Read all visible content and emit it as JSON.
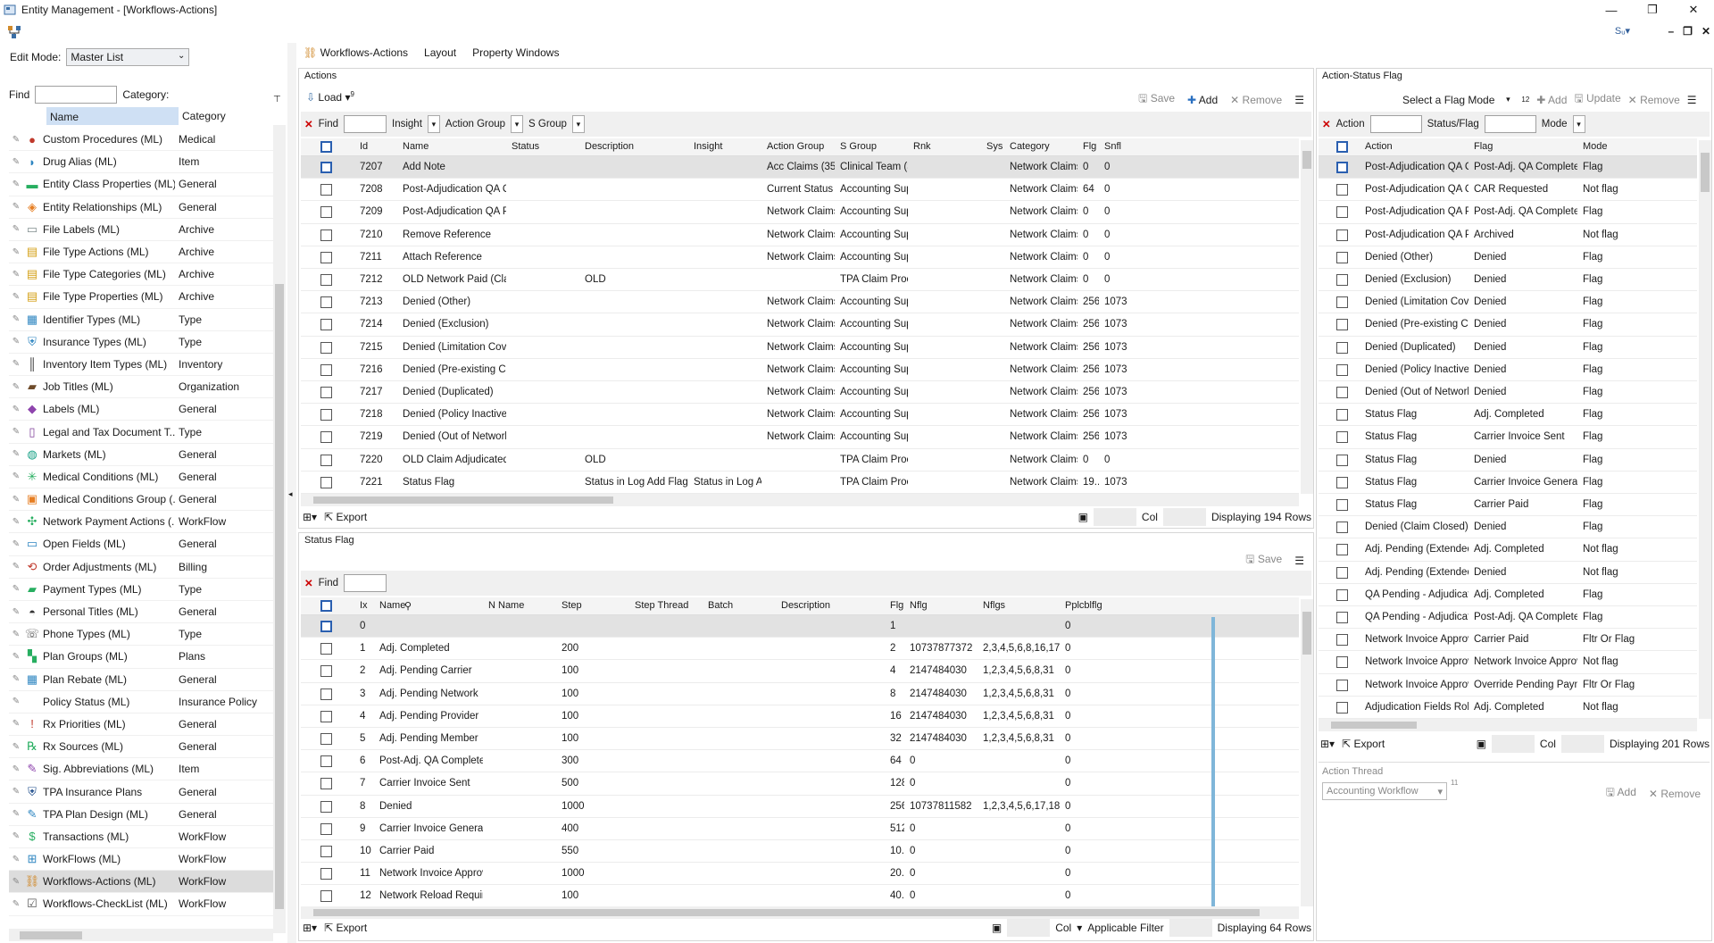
{
  "window": {
    "title": "Entity Management - [Workflows-Actions]",
    "controls": [
      "—",
      "❐",
      "✕"
    ],
    "mdi": [
      "–",
      "❐",
      "✕"
    ],
    "user_glyph": "Sᵤ▾"
  },
  "left": {
    "edit_mode_label": "Edit Mode:",
    "edit_mode_value": "Master List",
    "find_label": "Find",
    "category_label": "Category:",
    "col_name": "Name",
    "col_category": "Category",
    "items": [
      {
        "name": "Custom Procedures (ML)",
        "category": "Medical",
        "icon": "procedure-icon"
      },
      {
        "name": "Drug Alias (ML)",
        "category": "Item",
        "icon": "pill-icon"
      },
      {
        "name": "Entity Class Properties (ML)",
        "category": "General",
        "icon": "class-icon"
      },
      {
        "name": "Entity Relationships (ML)",
        "category": "General",
        "icon": "relationship-icon"
      },
      {
        "name": "File Labels (ML)",
        "category": "Archive",
        "icon": "label-icon"
      },
      {
        "name": "File Type Actions (ML)",
        "category": "Archive",
        "icon": "file-action-icon"
      },
      {
        "name": "File Type Categories (ML)",
        "category": "Archive",
        "icon": "file-category-icon"
      },
      {
        "name": "File Type Properties (ML)",
        "category": "Archive",
        "icon": "file-property-icon"
      },
      {
        "name": "Identifier Types (ML)",
        "category": "Type",
        "icon": "identifier-icon"
      },
      {
        "name": "Insurance Types (ML)",
        "category": "Type",
        "icon": "shield-icon"
      },
      {
        "name": "Inventory Item Types (ML)",
        "category": "Inventory",
        "icon": "barcode-icon"
      },
      {
        "name": "Job Titles (ML)",
        "category": "Organization",
        "icon": "briefcase-icon"
      },
      {
        "name": "Labels (ML)",
        "category": "General",
        "icon": "tag-icon"
      },
      {
        "name": "Legal and Tax Document T...",
        "category": "Type",
        "icon": "document-icon"
      },
      {
        "name": "Markets (ML)",
        "category": "General",
        "icon": "globe-icon"
      },
      {
        "name": "Medical Conditions (ML)",
        "category": "General",
        "icon": "virus-icon"
      },
      {
        "name": "Medical Conditions Group (...",
        "category": "General",
        "icon": "clipboard-icon"
      },
      {
        "name": "Network Payment Actions (...",
        "category": "WorkFlow",
        "icon": "network-icon"
      },
      {
        "name": "Open Fields (ML)",
        "category": "General",
        "icon": "field-icon"
      },
      {
        "name": "Order Adjustments (ML)",
        "category": "Billing",
        "icon": "adjust-icon"
      },
      {
        "name": "Payment Types (ML)",
        "category": "Type",
        "icon": "money-icon"
      },
      {
        "name": "Personal Titles (ML)",
        "category": "General",
        "icon": "hat-icon"
      },
      {
        "name": "Phone Types (ML)",
        "category": "Type",
        "icon": "phone-icon"
      },
      {
        "name": "Plan Groups (ML)",
        "category": "Plans",
        "icon": "plan-group-icon"
      },
      {
        "name": "Plan Rebate (ML)",
        "category": "General",
        "icon": "rebate-icon"
      },
      {
        "name": "Policy Status (ML)",
        "category": "Insurance Policy",
        "icon": ""
      },
      {
        "name": "Rx Priorities (ML)",
        "category": "General",
        "icon": "alert-icon"
      },
      {
        "name": "Rx Sources (ML)",
        "category": "General",
        "icon": "rx-icon"
      },
      {
        "name": "Sig. Abbreviations (ML)",
        "category": "Item",
        "icon": "sig-icon"
      },
      {
        "name": "TPA Insurance Plans",
        "category": "General",
        "icon": "tpa-shield-icon"
      },
      {
        "name": "TPA Plan Design (ML)",
        "category": "General",
        "icon": "design-icon"
      },
      {
        "name": "Transactions (ML)",
        "category": "WorkFlow",
        "icon": "transaction-icon"
      },
      {
        "name": "WorkFlows (ML)",
        "category": "WorkFlow",
        "icon": "workflow-icon"
      },
      {
        "name": "Workflows-Actions (ML)",
        "category": "WorkFlow",
        "icon": "workflow-actions-icon",
        "selected": true
      },
      {
        "name": "Workflows-CheckList (ML)",
        "category": "WorkFlow",
        "icon": "checklist-icon"
      }
    ]
  },
  "tabs": [
    "Workflows-Actions",
    "Layout",
    "Property Windows"
  ],
  "actions": {
    "title": "Actions",
    "load": "Load",
    "load_count": "9",
    "save": "Save",
    "add": "Add",
    "remove": "Remove",
    "find": "Find",
    "insight": "Insight",
    "action_group": "Action Group",
    "s_group": "S Group",
    "columns": [
      "Id",
      "Name",
      "Status",
      "Description",
      "Insight",
      "Action Group",
      "S Group",
      "Rnk",
      "Sys",
      "Category",
      "Flg",
      "Snfl"
    ],
    "rows": [
      [
        "7207",
        "Add Note",
        "",
        "",
        "",
        "Acc Claims (35), ...",
        "Clinical Team (31...",
        "",
        "",
        "Network Claims",
        "0",
        "0"
      ],
      [
        "7208",
        "Post-Adjudication QA Compl...",
        "",
        "",
        "",
        "Current Status Pr...",
        "Accounting Supe...",
        "",
        "",
        "Network Claims",
        "64",
        "0"
      ],
      [
        "7209",
        "Post-Adjudication QA Pending",
        "",
        "",
        "",
        "Network Claims A...",
        "Accounting Supe...",
        "",
        "",
        "Network Claims",
        "0",
        "0"
      ],
      [
        "7210",
        "Remove Reference",
        "",
        "",
        "",
        "Network Claims A...",
        "Accounting Supe...",
        "",
        "",
        "Network Claims",
        "0",
        "0"
      ],
      [
        "7211",
        "Attach Reference",
        "",
        "",
        "",
        "Network Claims A...",
        "Accounting Supe...",
        "",
        "",
        "Network Claims",
        "0",
        "0"
      ],
      [
        "7212",
        "OLD Network Paid (Claim Cl...",
        "",
        "OLD",
        "",
        "",
        "TPA Claim Proce...",
        "",
        "",
        "Network Claims",
        "0",
        "0"
      ],
      [
        "7213",
        "Denied (Other)",
        "",
        "",
        "",
        "Network Claims A...",
        "Accounting Supe...",
        "",
        "",
        "Network Claims",
        "256",
        "1073"
      ],
      [
        "7214",
        "Denied (Exclusion)",
        "",
        "",
        "",
        "Network Claims A...",
        "Accounting Supe...",
        "",
        "",
        "Network Claims",
        "256",
        "1073"
      ],
      [
        "7215",
        "Denied (Limitation Coverage)",
        "",
        "",
        "",
        "Network Claims A...",
        "Accounting Supe...",
        "",
        "",
        "Network Claims",
        "256",
        "1073"
      ],
      [
        "7216",
        "Denied (Pre-existing Conditi...",
        "",
        "",
        "",
        "Network Claims A...",
        "Accounting Supe...",
        "",
        "",
        "Network Claims",
        "256",
        "1073"
      ],
      [
        "7217",
        "Denied (Duplicated)",
        "",
        "",
        "",
        "Network Claims A...",
        "Accounting Supe...",
        "",
        "",
        "Network Claims",
        "256",
        "1073"
      ],
      [
        "7218",
        "Denied (Policy Inactive)",
        "",
        "",
        "",
        "Network Claims A...",
        "Accounting Supe...",
        "",
        "",
        "Network Claims",
        "256",
        "1073"
      ],
      [
        "7219",
        "Denied (Out of Network)",
        "",
        "",
        "",
        "Network Claims A...",
        "Accounting Supe...",
        "",
        "",
        "Network Claims",
        "256",
        "1073"
      ],
      [
        "7220",
        "OLD Claim Adjudicated (Net...",
        "",
        "OLD",
        "",
        "",
        "TPA Claim Proce...",
        "",
        "",
        "Network Claims",
        "0",
        "0"
      ],
      [
        "7221",
        "Status Flag",
        "",
        "Status in Log Add Flag to R...",
        "Status in Log Ad...",
        "",
        "TPA Claim Proce...",
        "",
        "",
        "Network Claims",
        "19...",
        "1073"
      ]
    ],
    "export": "Export",
    "col": "Col",
    "displaying": "Displaying 194 Rows"
  },
  "status_flag": {
    "title": "Status Flag",
    "save": "Save",
    "find": "Find",
    "columns": [
      "Ix",
      "Name",
      "N Name",
      "Step",
      "Step Thread",
      "Batch",
      "Description",
      "Flg",
      "Nflg",
      "Nflgs",
      "Pplcblflg"
    ],
    "rows": [
      [
        "0",
        "",
        "",
        "",
        "",
        "",
        "",
        "1",
        "",
        "",
        "0"
      ],
      [
        "1",
        "Adj. Completed",
        "",
        "200",
        "",
        "",
        "",
        "2",
        "10737877372",
        "2,3,4,5,6,8,16,17...",
        "0"
      ],
      [
        "2",
        "Adj. Pending Carrier",
        "",
        "100",
        "",
        "",
        "",
        "4",
        "2147484030",
        "1,2,3,4,5,6,8,31",
        "0"
      ],
      [
        "3",
        "Adj. Pending Network",
        "",
        "100",
        "",
        "",
        "",
        "8",
        "2147484030",
        "1,2,3,4,5,6,8,31",
        "0"
      ],
      [
        "4",
        "Adj. Pending Provider",
        "",
        "100",
        "",
        "",
        "",
        "16",
        "2147484030",
        "1,2,3,4,5,6,8,31",
        "0"
      ],
      [
        "5",
        "Adj. Pending Member",
        "",
        "100",
        "",
        "",
        "",
        "32",
        "2147484030",
        "1,2,3,4,5,6,8,31",
        "0"
      ],
      [
        "6",
        "Post-Adj. QA Completed",
        "",
        "300",
        "",
        "",
        "",
        "64",
        "0",
        "",
        "0"
      ],
      [
        "7",
        "Carrier Invoice Sent",
        "",
        "500",
        "",
        "",
        "",
        "128",
        "0",
        "",
        "0"
      ],
      [
        "8",
        "Denied",
        "",
        "1000",
        "",
        "",
        "",
        "256",
        "10737811582",
        "1,2,3,4,5,6,17,18...",
        "0"
      ],
      [
        "9",
        "Carrier Invoice Generated",
        "",
        "400",
        "",
        "",
        "",
        "512",
        "0",
        "",
        "0"
      ],
      [
        "10",
        "Carrier Paid",
        "",
        "550",
        "",
        "",
        "",
        "10...",
        "0",
        "",
        "0"
      ],
      [
        "11",
        "Network Invoice Approved",
        "",
        "1000",
        "",
        "",
        "",
        "20...",
        "0",
        "",
        "0"
      ],
      [
        "12",
        "Network Reload Required",
        "",
        "100",
        "",
        "",
        "",
        "40...",
        "0",
        "",
        "0"
      ]
    ],
    "export": "Export",
    "col": "Col",
    "applicable_filter": "Applicable Filter",
    "displaying": "Displaying 64 Rows"
  },
  "asf": {
    "title": "Action-Status Flag",
    "select_flag_mode": "Select a Flag Mode",
    "count": "12",
    "add": "Add",
    "update": "Update",
    "remove": "Remove",
    "action_label": "Action",
    "status_flag_label": "Status/Flag",
    "mode_label": "Mode",
    "columns": [
      "Action",
      "Flag",
      "Mode"
    ],
    "rows": [
      [
        "Post-Adjudication QA Compl...",
        "Post-Adj. QA Completed",
        "Flag"
      ],
      [
        "Post-Adjudication QA Compl...",
        "CAR Requested",
        "Not flag"
      ],
      [
        "Post-Adjudication QA Pending",
        "Post-Adj. QA Completed",
        "Flag"
      ],
      [
        "Post-Adjudication QA Pending",
        "Archived",
        "Not flag"
      ],
      [
        "Denied (Other)",
        "Denied",
        "Flag"
      ],
      [
        "Denied (Exclusion)",
        "Denied",
        "Flag"
      ],
      [
        "Denied (Limitation Coverage)",
        "Denied",
        "Flag"
      ],
      [
        "Denied (Pre-existing Conditi...",
        "Denied",
        "Flag"
      ],
      [
        "Denied (Duplicated)",
        "Denied",
        "Flag"
      ],
      [
        "Denied (Policy Inactive)",
        "Denied",
        "Flag"
      ],
      [
        "Denied (Out of Network)",
        "Denied",
        "Flag"
      ],
      [
        "Status Flag",
        "Adj. Completed",
        "Flag"
      ],
      [
        "Status Flag",
        "Carrier Invoice Sent",
        "Flag"
      ],
      [
        "Status Flag",
        "Denied",
        "Flag"
      ],
      [
        "Status Flag",
        "Carrier Invoice Generated",
        "Flag"
      ],
      [
        "Status Flag",
        "Carrier Paid",
        "Flag"
      ],
      [
        "Denied (Claim Closed)",
        "Denied",
        "Flag"
      ],
      [
        "Adj. Pending (Extended Ra...",
        "Adj. Completed",
        "Not flag"
      ],
      [
        "Adj. Pending (Extended Ra...",
        "Denied",
        "Not flag"
      ],
      [
        "QA Pending - Adjudicated",
        "Adj. Completed",
        "Flag"
      ],
      [
        "QA Pending - Adjudicated",
        "Post-Adj. QA Completed",
        "Flag"
      ],
      [
        "Network Invoice Approval P...",
        "Carrier Paid",
        "Fltr Or Flag"
      ],
      [
        "Network Invoice Approval P...",
        "Network Invoice Approved",
        "Not flag"
      ],
      [
        "Network Invoice Approval P...",
        "Override Pending Payment",
        "Fltr Or Flag"
      ],
      [
        "Adjudication Fields Rollback",
        "Adj. Completed",
        "Not flag"
      ]
    ],
    "export": "Export",
    "col": "Col",
    "displaying": "Displaying 201 Rows",
    "action_thread_title": "Action Thread",
    "thread_value": "Accounting Workflow",
    "thread_count": "11",
    "thread_add": "Add",
    "thread_remove": "Remove"
  }
}
